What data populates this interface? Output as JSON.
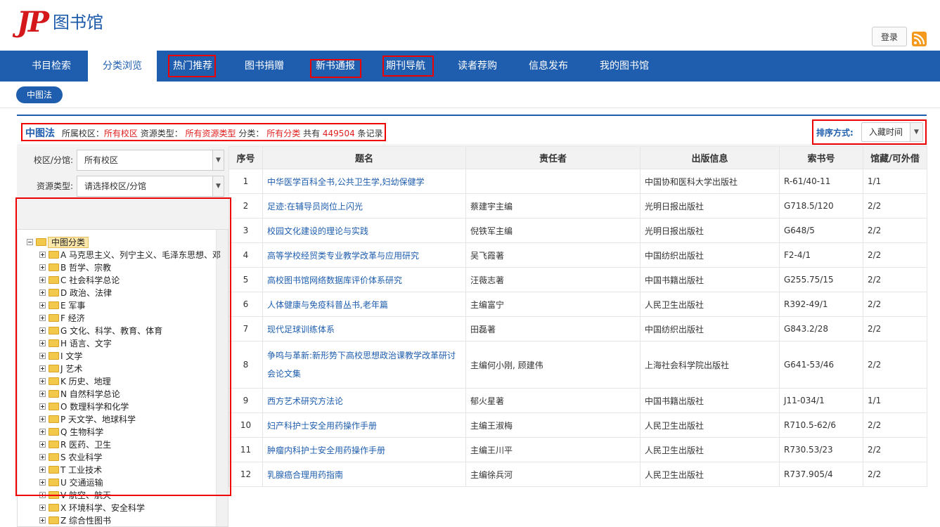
{
  "header": {
    "logo_mark": "JP",
    "logo_text": "图书馆",
    "login_label": "登录",
    "rss_icon": "rss-icon"
  },
  "nav": {
    "items": [
      {
        "label": "书目检索"
      },
      {
        "label": "分类浏览",
        "active": true
      },
      {
        "label": "热门推荐"
      },
      {
        "label": "图书捐赠"
      },
      {
        "label": "新书通报"
      },
      {
        "label": "期刊导航"
      },
      {
        "label": "读者荐购"
      },
      {
        "label": "信息发布"
      },
      {
        "label": "我的图书馆"
      }
    ]
  },
  "breadcrumb": {
    "label": "中图法"
  },
  "info": {
    "title": "中图法",
    "campus_label": "所属校区：",
    "campus_value": "所有校区",
    "resource_label": "资源类型：",
    "resource_value": "所有资源类型",
    "category_label": "分类：",
    "category_value": "所有分类",
    "count_prefix": "共有",
    "count_value": "449504",
    "count_suffix": "条记录"
  },
  "sort": {
    "label": "排序方式:",
    "value": "入藏时间"
  },
  "filters": {
    "campus_label": "校区/分馆:",
    "campus_value": "所有校区",
    "resource_label": "资源类型:",
    "resource_value": "请选择校区/分馆"
  },
  "tree": {
    "root": "中图分类",
    "children": [
      "A 马克思主义、列宁主义、毛泽东思想、邓",
      "B 哲学、宗教",
      "C 社会科学总论",
      "D 政治、法律",
      "E 军事",
      "F 经济",
      "G 文化、科学、教育、体育",
      "H 语言、文字",
      "I 文学",
      "J 艺术",
      "K 历史、地理",
      "N 自然科学总论",
      "O 数理科学和化学",
      "P 天文学、地球科学",
      "Q 生物科学",
      "R 医药、卫生",
      "S 农业科学",
      "T 工业技术",
      "U 交通运输",
      "V 航空、航天",
      "X 环境科学、安全科学",
      "Z 综合性图书"
    ]
  },
  "table": {
    "headers": [
      "序号",
      "题名",
      "责任者",
      "出版信息",
      "索书号",
      "馆藏/可外借"
    ],
    "rows": [
      [
        "1",
        "中华医学百科全书,公共卫生学,妇幼保健学",
        "",
        "中国协和医科大学出版社",
        "R-61/40-11",
        "1/1"
      ],
      [
        "2",
        "足迹:在辅导员岗位上闪光",
        "蔡建宇主编",
        "光明日报出版社",
        "G718.5/120",
        "2/2"
      ],
      [
        "3",
        "校园文化建设的理论与实践",
        "倪铁军主编",
        "光明日报出版社",
        "G648/5",
        "2/2"
      ],
      [
        "4",
        "高等学校经贸类专业教学改革与应用研究",
        "吴飞霞著",
        "中国纺织出版社",
        "F2-4/1",
        "2/2"
      ],
      [
        "5",
        "高校图书馆网络数据库评价体系研究",
        "汪薇志著",
        "中国书籍出版社",
        "G255.75/15",
        "2/2"
      ],
      [
        "6",
        "人体健康与免疫科普丛书,老年篇",
        "主编富宁",
        "人民卫生出版社",
        "R392-49/1",
        "2/2"
      ],
      [
        "7",
        "现代足球训练体系",
        "田磊著",
        "中国纺织出版社",
        "G843.2/28",
        "2/2"
      ],
      [
        "8",
        "争鸣与革新:新形势下高校思想政治课教学改革研讨会论文集",
        "主编何小刚, 顾建伟",
        "上海社会科学院出版社",
        "G641-53/46",
        "2/2"
      ],
      [
        "9",
        "西方艺术研究方法论",
        "郁火星著",
        "中国书籍出版社",
        "J11-034/1",
        "1/1"
      ],
      [
        "10",
        "妇产科护士安全用药操作手册",
        "主编王淑梅",
        "人民卫生出版社",
        "R710.5-62/6",
        "2/2"
      ],
      [
        "11",
        "肿瘤内科护士安全用药操作手册",
        "主编王川平",
        "人民卫生出版社",
        "R730.53/23",
        "2/2"
      ],
      [
        "12",
        "乳腺癌合理用药指南",
        "主编徐兵河",
        "人民卫生出版社",
        "R737.905/4",
        "2/2"
      ]
    ]
  },
  "colors": {
    "brand_blue": "#1f5eae",
    "highlight_red": "#e02020",
    "logo_red": "#d3171b"
  }
}
